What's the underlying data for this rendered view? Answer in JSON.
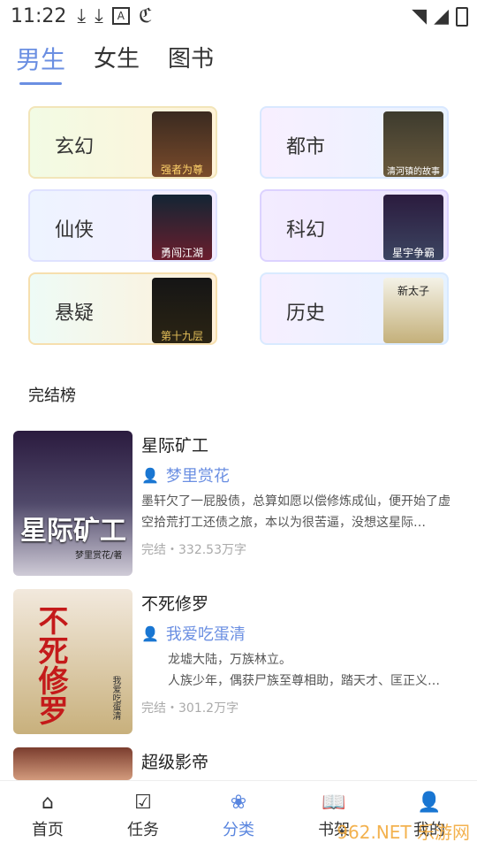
{
  "status": {
    "time": "11:22"
  },
  "tabs": [
    {
      "label": "男生",
      "active": true
    },
    {
      "label": "女生",
      "active": false
    },
    {
      "label": "图书",
      "active": false
    }
  ],
  "categories": [
    {
      "label": "玄幻",
      "cover_text": "强者为尊",
      "bg": "#f4fbe6"
    },
    {
      "label": "都市",
      "cover_text": "清河镇的故事",
      "bg": "#eef5ff"
    },
    {
      "label": "仙侠",
      "cover_text": "勇闯江湖",
      "bg": "#eef2ff"
    },
    {
      "label": "科幻",
      "cover_text": "星宇争霸",
      "bg": "#f1ecff"
    },
    {
      "label": "悬疑",
      "cover_text": "第十九层",
      "bg": "#eefbf6"
    },
    {
      "label": "历史",
      "cover_text": "新太子",
      "bg": "#eef4ff"
    }
  ],
  "section": {
    "title": "完结榜"
  },
  "books": [
    {
      "title": "星际矿工",
      "author": "梦里赏花",
      "desc": "墨轩欠了一屁股债，总算如愿以偿修炼成仙，便开始了虚空拾荒打工还债之旅，本以为很苦逼，没想这星际…",
      "meta": "完结・332.53万字",
      "cover_title": "星际矿工",
      "cover_sub": "梦里赏花/著"
    },
    {
      "title": "不死修罗",
      "author": "我爱吃蛋清",
      "desc": "龙墟大陆，万族林立。\n人族少年，偶获尸族至尊相助，踏天才、匡正义…",
      "meta": "完结・301.2万字",
      "cover_title": "不死修罗",
      "cover_sub": "我爱吃蛋清"
    },
    {
      "title": "超级影帝"
    }
  ],
  "bottom_nav": [
    {
      "label": "首页",
      "icon": "home-icon",
      "active": false
    },
    {
      "label": "任务",
      "icon": "task-icon",
      "active": false
    },
    {
      "label": "分类",
      "icon": "category-icon",
      "active": true
    },
    {
      "label": "书架",
      "icon": "bookshelf-icon",
      "active": false
    },
    {
      "label": "我的",
      "icon": "user-icon",
      "active": false
    }
  ],
  "watermark": "962.NET 乐游网",
  "colors": {
    "accent": "#6b8fe2"
  }
}
